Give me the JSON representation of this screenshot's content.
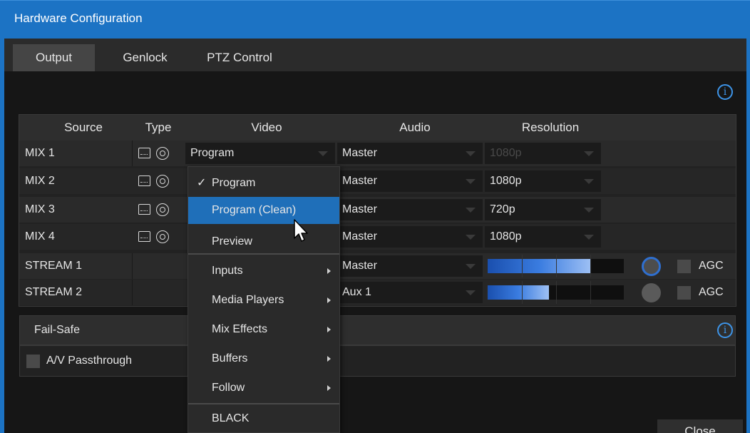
{
  "window": {
    "title": "Hardware Configuration"
  },
  "tabs": [
    {
      "label": "Output",
      "active": true
    },
    {
      "label": "Genlock",
      "active": false
    },
    {
      "label": "PTZ Control",
      "active": false
    }
  ],
  "info_glyph": "i",
  "table": {
    "headers": {
      "source": "Source",
      "type": "Type",
      "video": "Video",
      "audio": "Audio",
      "resolution": "Resolution"
    },
    "rows": [
      {
        "source": "MIX 1",
        "video": "Program",
        "audio": "Master",
        "resolution": "1080p"
      },
      {
        "source": "MIX 2",
        "video": "",
        "audio": "Master",
        "resolution": "1080p"
      },
      {
        "source": "MIX 3",
        "video": "",
        "audio": "Master",
        "resolution": "720p"
      },
      {
        "source": "MIX 4",
        "video": "",
        "audio": "Master",
        "resolution": "1080p"
      },
      {
        "source": "STREAM 1",
        "video": "",
        "audio": "Master",
        "level": 0.76,
        "agc": "AGC"
      },
      {
        "source": "STREAM 2",
        "video": "",
        "audio": "Aux 1",
        "level": 0.45,
        "agc": "AGC"
      }
    ]
  },
  "failsafe": {
    "title": "Fail-Safe",
    "passthrough_label": "A/V Passthrough"
  },
  "close_label": "Close",
  "video_menu": {
    "items": [
      {
        "label": "Program",
        "checked": true,
        "check": "✓"
      },
      {
        "label": "Program (Clean)",
        "highlighted": true
      },
      {
        "label": "Preview"
      },
      {
        "label": "Inputs",
        "submenu": true
      },
      {
        "label": "Media Players",
        "submenu": true
      },
      {
        "label": "Mix Effects",
        "submenu": true
      },
      {
        "label": "Buffers",
        "submenu": true
      },
      {
        "label": "Follow",
        "submenu": true
      },
      {
        "label": "BLACK"
      }
    ]
  },
  "colors": {
    "accent": "#1c73c4",
    "highlight": "#1f6fb9",
    "meter": "#3a7ce0"
  }
}
